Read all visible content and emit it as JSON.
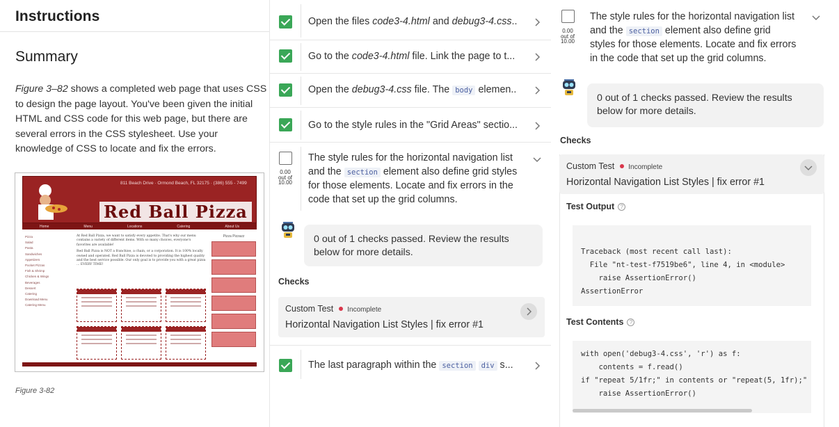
{
  "instructions": {
    "header": "Instructions",
    "summary_title": "Summary",
    "summary_fig_ref": "Figure 3–82",
    "summary_rest": " shows a completed web page that uses CSS to design the page layout. You've been given the initial HTML and CSS code for this web page, but there are several errors in the CSS stylesheet. Use your knowledge of CSS to locate and fix the errors.",
    "caption": "Figure 3-82",
    "figure": {
      "title": "Red Ball Pizza",
      "address": "811 Beach Drive · Ormond Beach, FL 32175 · (386) 555 - 7499",
      "nav": [
        "Home",
        "Menu",
        "Locations",
        "Catering",
        "About Us"
      ],
      "sidebar": [
        "Pizza",
        "Salad",
        "Pasta",
        "Sandwiches",
        "Appetizers",
        "Pocket Pizzas",
        "Fish & Shrimp",
        "Chicken & Wings",
        "Beverages",
        "Dessert",
        "Catering",
        "Download Menu",
        "Catering Menu"
      ],
      "right_label": "Pizza Pizzazz",
      "para1": "At Red Ball Pizza, we want to satisfy every appetite. That's why our menu contains a variety of different items. With so many choices, everyone's favorites are available!",
      "para2": "Red Ball Pizza is NOT a franchise, a chain, or a corporation. It is 100% locally owned and operated. Red Ball Pizza is devoted to providing the highest quality and the best service possible. Our only goal is to provide you with a great pizza ... EVERY TIME!"
    }
  },
  "steps": [
    {
      "done": true,
      "pre": "Open the files ",
      "em1": "code3-4.html",
      "mid": " and ",
      "em2": "debug3-4.css",
      "post": "..."
    },
    {
      "done": true,
      "pre": "Go to the ",
      "em1": "code3-4.html",
      "mid": " file. Link the page to t...",
      "em2": "",
      "post": ""
    },
    {
      "done": true,
      "pre": "Open the ",
      "em1": "debug3-4.css",
      "mid": " file. The ",
      "code": "body",
      "post": " elemen..."
    },
    {
      "done": true,
      "pre": "Go to the style rules in the \"Grid Areas\" sectio...",
      "em1": "",
      "mid": "",
      "em2": "",
      "post": ""
    }
  ],
  "expanded_step": {
    "line1": "The style rules for the horizontal navigation list",
    "line2_pre": "and the ",
    "line2_code": "section",
    "line2_post": " element also define grid styles",
    "line3": "for those elements. Locate and fix errors in the",
    "line4": "code that set up the grid columns.",
    "score_val": "0.00",
    "score_of": "out of",
    "score_max": "10.00"
  },
  "right_step": {
    "line1": "The style rules for the horizontal navigation list",
    "line2_pre": "and the ",
    "line2_code": "section",
    "line2_post": " element also define grid",
    "line3": "styles for those elements. Locate and fix errors",
    "line4": "in the code that set up the grid columns."
  },
  "result": {
    "line1": "0 out of 1 checks passed. Review the results",
    "line2": "below for more details."
  },
  "checks_heading": "Checks",
  "custom_test": {
    "label": "Custom Test",
    "status": "Incomplete",
    "title": "Horizontal Navigation List Styles | fix error #1"
  },
  "last_step": {
    "pre": "The last paragraph within the ",
    "code1": "section",
    "code2": "div",
    "post": " s..."
  },
  "test_output_label": "Test Output",
  "test_output": [
    "Traceback (most recent call last):",
    "  File \"nt-test-f7519be6\", line 4, in <module>",
    "    raise AssertionError()",
    "AssertionError"
  ],
  "test_contents_label": "Test Contents",
  "test_contents": [
    "with open('debug3-4.css', 'r') as f:",
    "    contents = f.read()",
    "if \"repeat 5/1fr;\" in contents or \"repeat(5, 1fr);\" i",
    "    raise AssertionError()"
  ]
}
